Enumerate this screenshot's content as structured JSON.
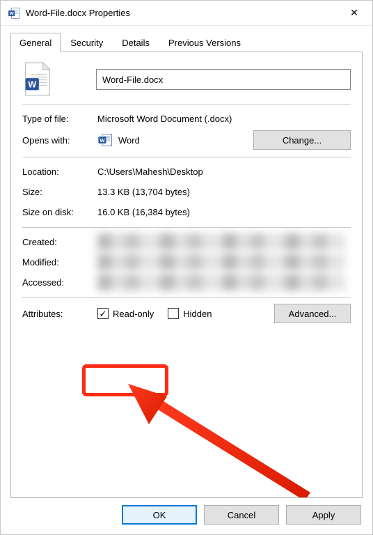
{
  "titlebar": {
    "title": "Word-File.docx Properties"
  },
  "tabs": {
    "t0": "General",
    "t1": "Security",
    "t2": "Details",
    "t3": "Previous Versions",
    "active": 0
  },
  "general": {
    "filename": "Word-File.docx",
    "type_label": "Type of file:",
    "type_value": "Microsoft Word Document (.docx)",
    "opens_label": "Opens with:",
    "opens_value": "Word",
    "change_btn": "Change...",
    "location_label": "Location:",
    "location_value": "C:\\Users\\Mahesh\\Desktop",
    "size_label": "Size:",
    "size_value": "13.3 KB (13,704 bytes)",
    "size_on_disk_label": "Size on disk:",
    "size_on_disk_value": "16.0 KB (16,384 bytes)",
    "created_label": "Created:",
    "modified_label": "Modified:",
    "accessed_label": "Accessed:",
    "attributes_label": "Attributes:",
    "readonly_label": "Read-only",
    "readonly_checked": true,
    "hidden_label": "Hidden",
    "hidden_checked": false,
    "advanced_btn": "Advanced..."
  },
  "buttons": {
    "ok": "OK",
    "cancel": "Cancel",
    "apply": "Apply"
  }
}
